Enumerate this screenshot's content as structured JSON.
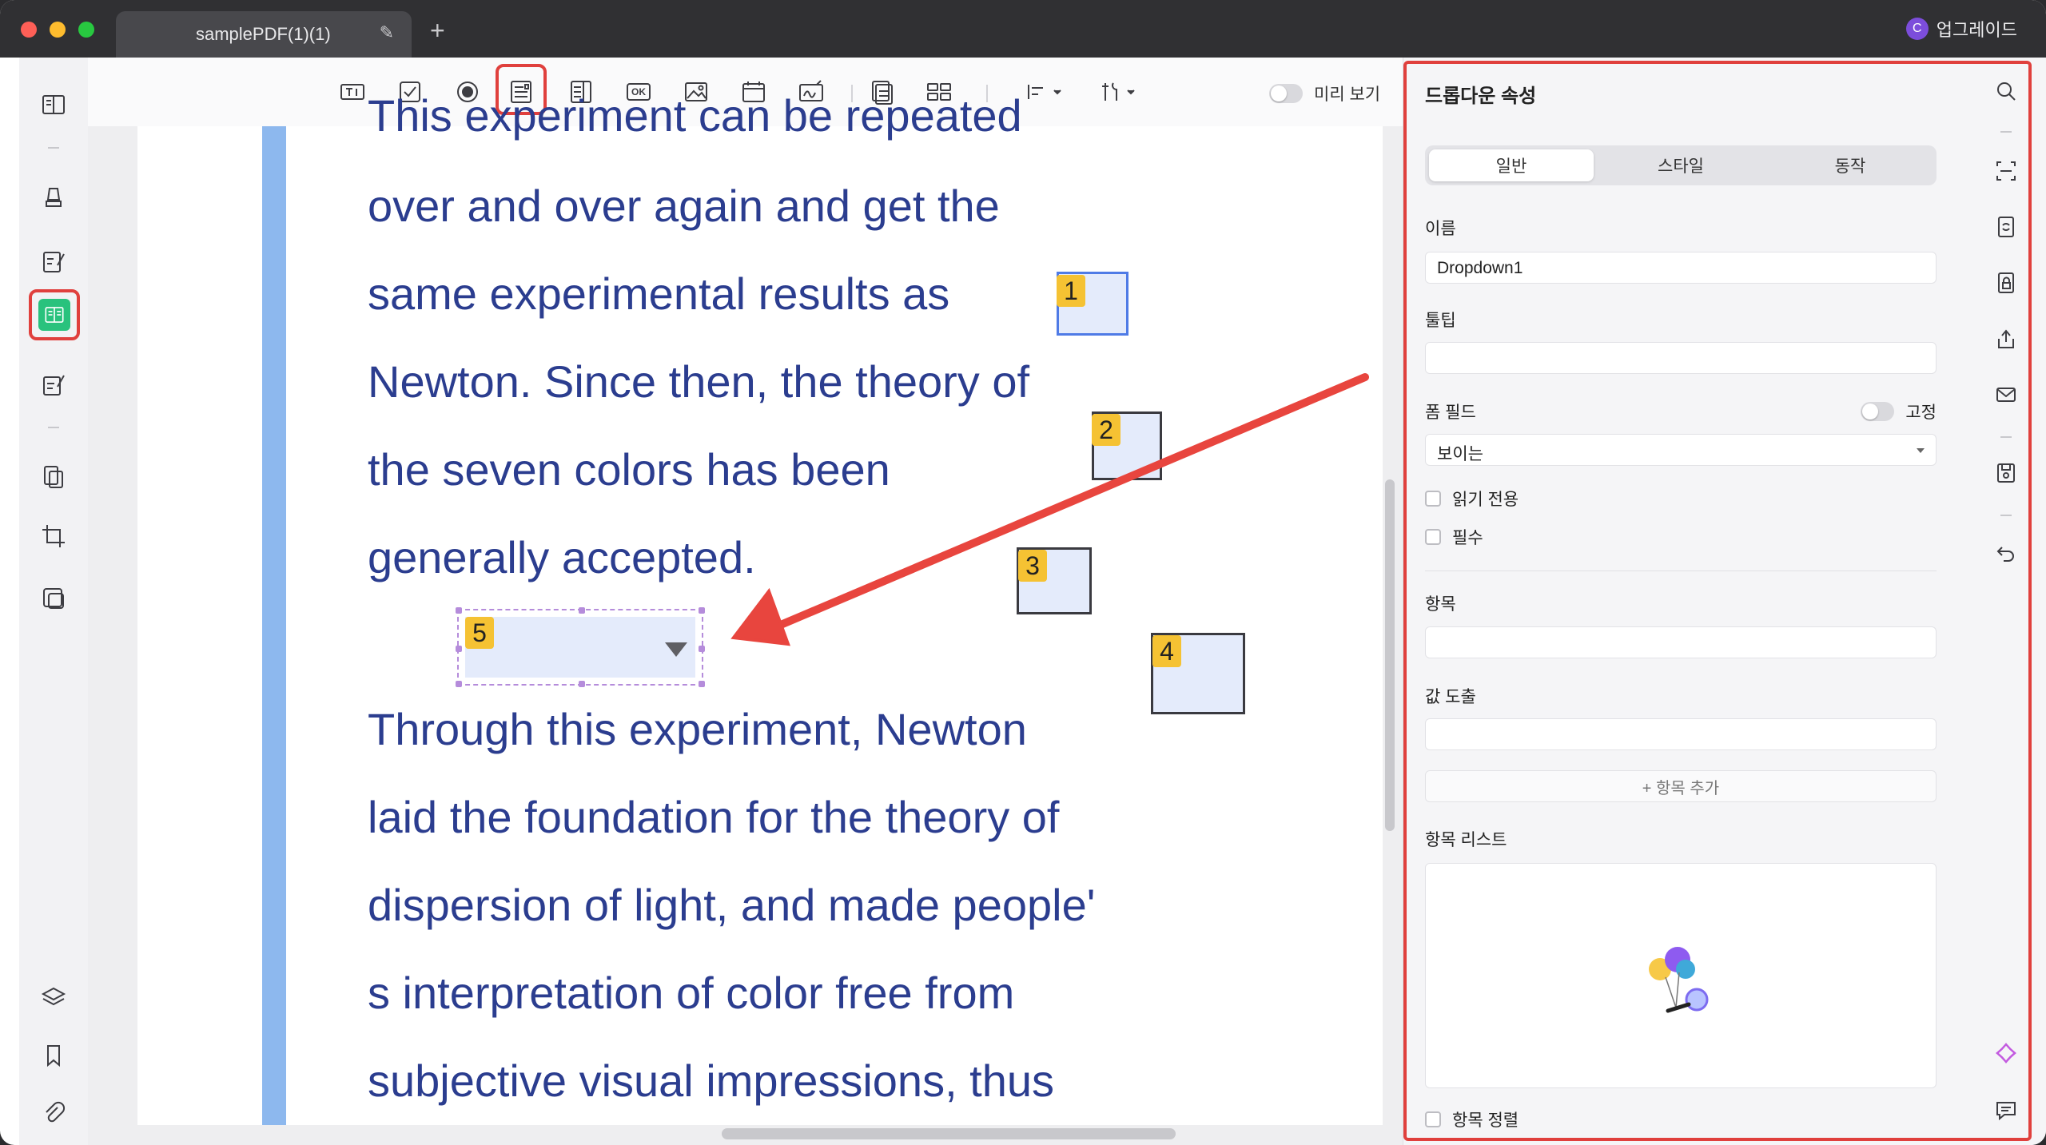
{
  "window": {
    "tab_title": "samplePDF(1)(1)",
    "new_tab_symbol": "+",
    "upgrade_label": "업그레이드",
    "avatar_letter": "C"
  },
  "toolbar": {
    "tools": [
      "text-field-icon",
      "checkbox-icon",
      "radio-button-icon",
      "dropdown-icon",
      "list-box-icon",
      "button-icon",
      "image-field-icon",
      "date-field-icon",
      "signature-field-icon",
      "form-recognition-icon",
      "grid-icon",
      "align-icon",
      "tools-icon"
    ],
    "button_tool_text": "OK",
    "preview_label": "미리 보기"
  },
  "document": {
    "lines": [
      "This experiment can be repeated",
      "over and over again and get the",
      "same experimental results as",
      "Newton. Since then, the theory of",
      "the seven colors has been",
      "generally accepted.",
      "Through this experiment, Newton",
      "laid the foundation for the theory of",
      "dispersion of light, and made people'",
      "s interpretation of color free from",
      "subjective visual impressions, thus"
    ],
    "field_numbers": [
      "1",
      "2",
      "3",
      "4",
      "5"
    ]
  },
  "panel": {
    "title": "드롭다운 속성",
    "tabs": [
      "일반",
      "스타일",
      "동작"
    ],
    "name_label": "이름",
    "name_value": "Dropdown1",
    "tooltip_label": "툴팁",
    "tooltip_value": "",
    "form_field_label": "폼 필드",
    "fixed_label": "고정",
    "visibility_value": "보이는",
    "readonly_label": "읽기 전용",
    "required_label": "필수",
    "item_label": "항목",
    "item_value": "",
    "export_label": "값 도출",
    "export_value": "",
    "add_item_label": "+ 항목 추가",
    "item_list_label": "항목 리스트",
    "sort_label": "항목 정렬"
  },
  "colors": {
    "accent_red": "#e0403d",
    "doc_text": "#2b3d8f",
    "field_fill": "#e4ebfb",
    "active_green": "#29c27d",
    "field_number_bg": "#f5c233"
  }
}
